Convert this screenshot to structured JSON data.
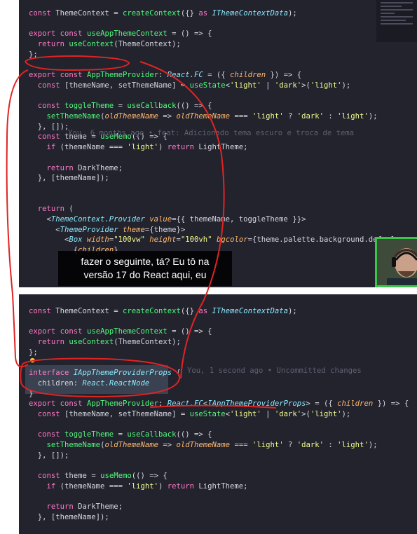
{
  "colors": {
    "background": "#23232e",
    "keyword": "#ff79c6",
    "function": "#50fa7b",
    "string": "#f1fa8c",
    "type": "#8be9fd",
    "param": "#ffb86c",
    "plain": "#d6d6e0",
    "comment": "#5f6070",
    "annotation": "#e02424",
    "webcam_border": "#3cc54a"
  },
  "top_code": [
    [
      [
        "const ",
        "k"
      ],
      [
        "ThemeContext ",
        "v"
      ],
      [
        "= ",
        "p"
      ],
      [
        "createContext",
        "f"
      ],
      [
        "({} ",
        "p"
      ],
      [
        "as ",
        "k"
      ],
      [
        "IThemeContextData",
        "t"
      ],
      [
        ");",
        "p"
      ]
    ],
    [],
    [
      [
        "export ",
        "k"
      ],
      [
        "const ",
        "k"
      ],
      [
        "useAppThemeContext ",
        "f"
      ],
      [
        "= () => {",
        "p"
      ]
    ],
    [
      [
        "  return ",
        "k"
      ],
      [
        "useContext",
        "f"
      ],
      [
        "(ThemeContext);",
        "p"
      ]
    ],
    [
      [
        "};",
        "p"
      ]
    ],
    [],
    [
      [
        "export ",
        "k"
      ],
      [
        "const ",
        "k"
      ],
      [
        "AppThemeProvider",
        "f"
      ],
      [
        ": ",
        "p"
      ],
      [
        "React.FC ",
        "t"
      ],
      [
        "= ({ ",
        "p"
      ],
      [
        "children ",
        "a"
      ],
      [
        "}) => {",
        "p"
      ]
    ],
    [
      [
        "  const ",
        "k"
      ],
      [
        "[themeName, setThemeName] ",
        "p"
      ],
      [
        "= ",
        "p"
      ],
      [
        "useState",
        "f"
      ],
      [
        "<",
        "p"
      ],
      [
        "'light'",
        "s"
      ],
      [
        " | ",
        "p"
      ],
      [
        "'dark'",
        "s"
      ],
      [
        ">(",
        "p"
      ],
      [
        "'light'",
        "s"
      ],
      [
        ");",
        "p"
      ]
    ],
    [],
    [
      [
        "  const ",
        "k"
      ],
      [
        "toggleTheme ",
        "f"
      ],
      [
        "= ",
        "p"
      ],
      [
        "useCallback",
        "f"
      ],
      [
        "(() => {",
        "p"
      ]
    ],
    [
      [
        "    setThemeName",
        "f"
      ],
      [
        "(",
        "p"
      ],
      [
        "oldThemeName ",
        "a"
      ],
      [
        "=> ",
        "p"
      ],
      [
        "oldThemeName ",
        "a"
      ],
      [
        "=== ",
        "p"
      ],
      [
        "'light' ",
        "s"
      ],
      [
        "? ",
        "p"
      ],
      [
        "'dark' ",
        "s"
      ],
      [
        ": ",
        "p"
      ],
      [
        "'light'",
        "s"
      ],
      [
        ");",
        "p"
      ]
    ],
    [
      [
        "  }, []);",
        "p"
      ]
    ],
    [
      [
        "  const ",
        "k"
      ],
      [
        "theme ",
        "v"
      ],
      [
        "= ",
        "p"
      ],
      [
        "useMemo",
        "f"
      ],
      [
        "(() => {",
        "p"
      ]
    ],
    [
      [
        "    if ",
        "k"
      ],
      [
        "(themeName === ",
        "p"
      ],
      [
        "'light'",
        "s"
      ],
      [
        ") ",
        "p"
      ],
      [
        "return ",
        "k"
      ],
      [
        "LightTheme;",
        "p"
      ]
    ],
    [],
    [
      [
        "    return ",
        "k"
      ],
      [
        "DarkTheme;",
        "p"
      ]
    ],
    [
      [
        "  }, [themeName]);",
        "p"
      ]
    ],
    [],
    [],
    [
      [
        "  return ",
        "k"
      ],
      [
        "(",
        "p"
      ]
    ],
    [
      [
        "    <",
        "p"
      ],
      [
        "ThemeContext.Provider ",
        "t"
      ],
      [
        "value",
        "a"
      ],
      [
        "={{ themeName, toggleTheme }}>",
        "p"
      ]
    ],
    [
      [
        "      <",
        "p"
      ],
      [
        "ThemeProvider ",
        "t"
      ],
      [
        "theme",
        "a"
      ],
      [
        "={theme}>",
        "p"
      ]
    ],
    [
      [
        "        <",
        "p"
      ],
      [
        "Box ",
        "t"
      ],
      [
        "width",
        "a"
      ],
      [
        "=",
        "p"
      ],
      [
        "\"100vw\" ",
        "s"
      ],
      [
        "height",
        "a"
      ],
      [
        "=",
        "p"
      ],
      [
        "\"100vh\" ",
        "s"
      ],
      [
        "bgcolor",
        "a"
      ],
      [
        "={theme.palette.background.defaul",
        "p"
      ]
    ],
    [
      [
        "          {",
        "p"
      ],
      [
        "children",
        "a"
      ],
      [
        "}",
        "p"
      ]
    ]
  ],
  "top_blame": "You, 6 months ago • feat: Adicionado tema escuro e troca de tema",
  "caption_lines": [
    "fazer o seguinte, tá? Eu tô na",
    "versão 17 do React aqui, eu"
  ],
  "bottom_code": [
    [
      [
        "const ",
        "k"
      ],
      [
        "ThemeContext ",
        "v"
      ],
      [
        "= ",
        "p"
      ],
      [
        "createContext",
        "f"
      ],
      [
        "({} ",
        "p"
      ],
      [
        "as ",
        "k"
      ],
      [
        "IThemeContextData",
        "t"
      ],
      [
        ");",
        "p"
      ]
    ],
    [],
    [
      [
        "export ",
        "k"
      ],
      [
        "const ",
        "k"
      ],
      [
        "useAppThemeContext ",
        "f"
      ],
      [
        "= () => {",
        "p"
      ]
    ],
    [
      [
        "  return ",
        "k"
      ],
      [
        "useContext",
        "f"
      ],
      [
        "(ThemeContext);",
        "p"
      ]
    ],
    [
      [
        "};",
        "p"
      ]
    ],
    [],
    [
      [
        "interface ",
        "k"
      ],
      [
        "IAppThemeProviderProps ",
        "t"
      ],
      [
        "{",
        "p"
      ]
    ],
    [
      [
        "  children",
        "v"
      ],
      [
        ": ",
        "p"
      ],
      [
        "React.ReactNode",
        "t"
      ]
    ],
    [
      [
        "}",
        "p"
      ]
    ],
    [
      [
        "export ",
        "k"
      ],
      [
        "const ",
        "k"
      ],
      [
        "AppThemeProvider",
        "f"
      ],
      [
        ": ",
        "p"
      ],
      [
        "React.FC",
        "t"
      ],
      [
        "<",
        "p"
      ],
      [
        "IAppThemeProviderProps",
        "t"
      ],
      [
        "> ",
        "p"
      ],
      [
        "= ({ ",
        "p"
      ],
      [
        "children ",
        "a"
      ],
      [
        "}) => {",
        "p"
      ]
    ],
    [
      [
        "  const ",
        "k"
      ],
      [
        "[themeName, setThemeName] ",
        "p"
      ],
      [
        "= ",
        "p"
      ],
      [
        "useState",
        "f"
      ],
      [
        "<",
        "p"
      ],
      [
        "'light'",
        "s"
      ],
      [
        " | ",
        "p"
      ],
      [
        "'dark'",
        "s"
      ],
      [
        ">(",
        "p"
      ],
      [
        "'light'",
        "s"
      ],
      [
        ");",
        "p"
      ]
    ],
    [],
    [
      [
        "  const ",
        "k"
      ],
      [
        "toggleTheme ",
        "f"
      ],
      [
        "= ",
        "p"
      ],
      [
        "useCallback",
        "f"
      ],
      [
        "(() => {",
        "p"
      ]
    ],
    [
      [
        "    setThemeName",
        "f"
      ],
      [
        "(",
        "p"
      ],
      [
        "oldThemeName ",
        "a"
      ],
      [
        "=> ",
        "p"
      ],
      [
        "oldThemeName ",
        "a"
      ],
      [
        "=== ",
        "p"
      ],
      [
        "'light' ",
        "s"
      ],
      [
        "? ",
        "p"
      ],
      [
        "'dark' ",
        "s"
      ],
      [
        ": ",
        "p"
      ],
      [
        "'light'",
        "s"
      ],
      [
        ");",
        "p"
      ]
    ],
    [
      [
        "  }, []);",
        "p"
      ]
    ],
    [],
    [
      [
        "  const ",
        "k"
      ],
      [
        "theme ",
        "v"
      ],
      [
        "= ",
        "p"
      ],
      [
        "useMemo",
        "f"
      ],
      [
        "(() => {",
        "p"
      ]
    ],
    [
      [
        "    if ",
        "k"
      ],
      [
        "(themeName === ",
        "p"
      ],
      [
        "'light'",
        "s"
      ],
      [
        ") ",
        "p"
      ],
      [
        "return ",
        "k"
      ],
      [
        "LightTheme;",
        "p"
      ]
    ],
    [],
    [
      [
        "    return ",
        "k"
      ],
      [
        "DarkTheme;",
        "p"
      ]
    ],
    [
      [
        "  }, [themeName]);",
        "p"
      ]
    ]
  ],
  "bottom_blame": "You, 1 second ago • Uncommitted changes"
}
